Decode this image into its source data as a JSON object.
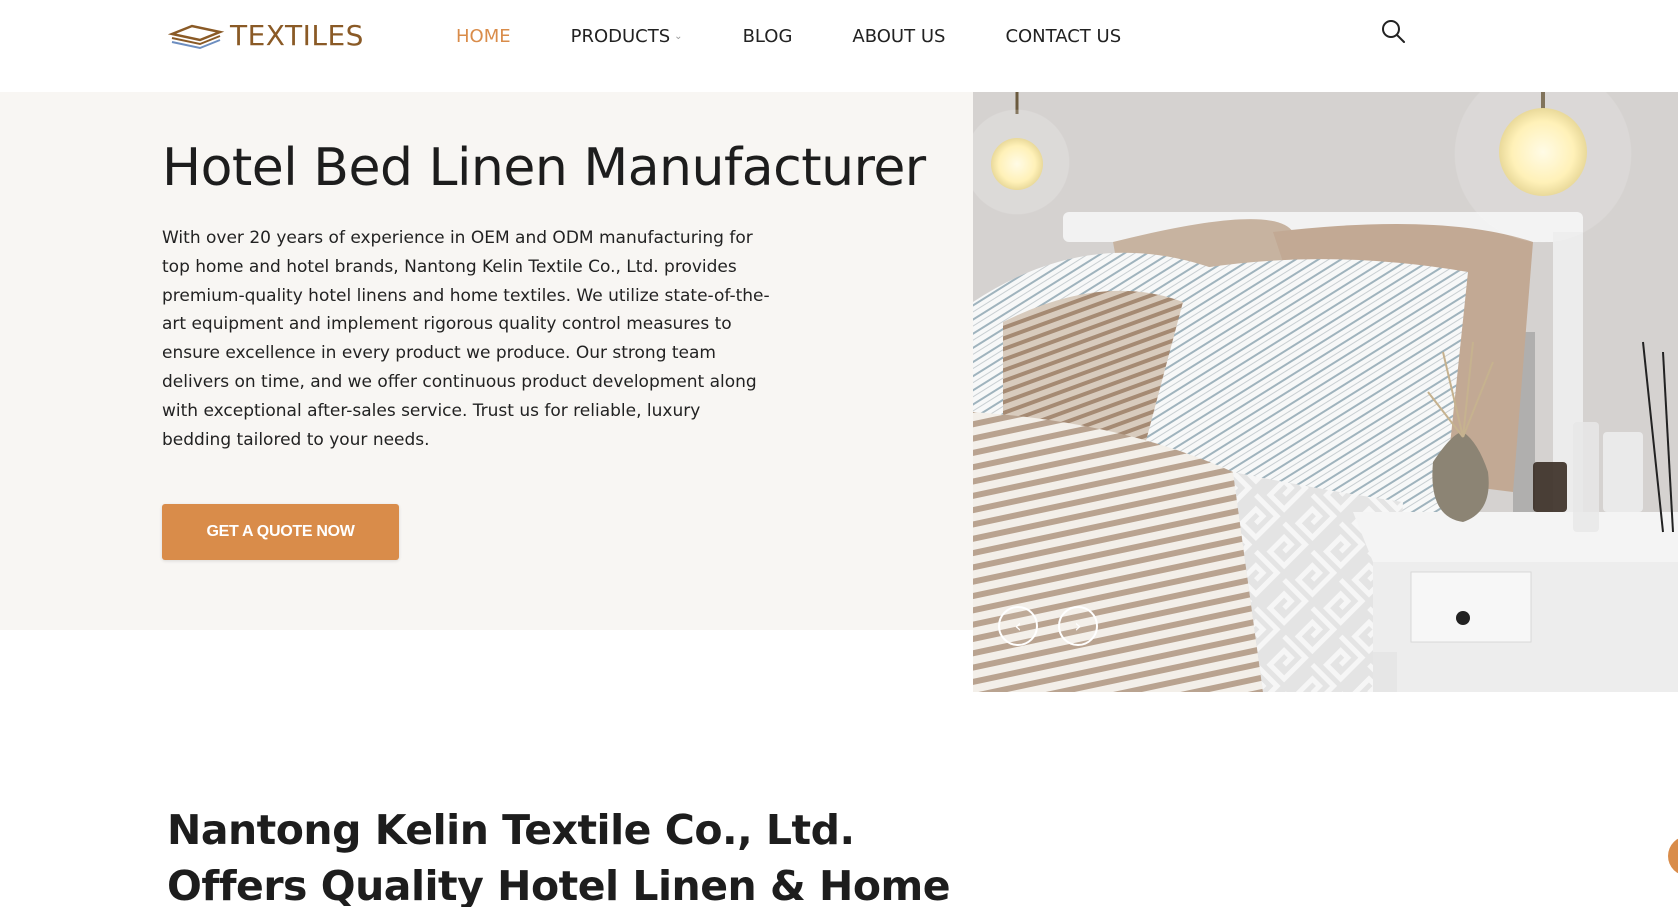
{
  "brand": {
    "logo_text": "TEXTILES",
    "accent_color": "#d98c4a"
  },
  "nav": {
    "items": [
      {
        "label": "HOME",
        "active": true
      },
      {
        "label": "PRODUCTS",
        "active": false,
        "has_dropdown": true
      },
      {
        "label": "BLOG",
        "active": false
      },
      {
        "label": "ABOUT US",
        "active": false
      },
      {
        "label": "CONTACT US",
        "active": false
      }
    ],
    "search_icon": "search-icon"
  },
  "hero": {
    "title": "Hotel Bed Linen Manufacturer",
    "description": "With over 20 years of experience in OEM and ODM manufacturing for top home and hotel brands, Nantong Kelin Textile Co., Ltd. provides premium-quality hotel linens and home textiles. We utilize state-of-the-art equipment and implement rigorous quality control measures to ensure excellence in every product we produce. Our strong team delivers on time, and we offer continuous product development along with exceptional after-sales service. Trust us for reliable, luxury bedding tailored to your needs.",
    "cta_label": "GET A QUOTE NOW",
    "slider_prev": "‹",
    "slider_next": "›"
  },
  "intro": {
    "title_line1": "Nantong Kelin Textile Co., Ltd.",
    "title_line2": "Offers Quality Hotel Linen & Home"
  }
}
